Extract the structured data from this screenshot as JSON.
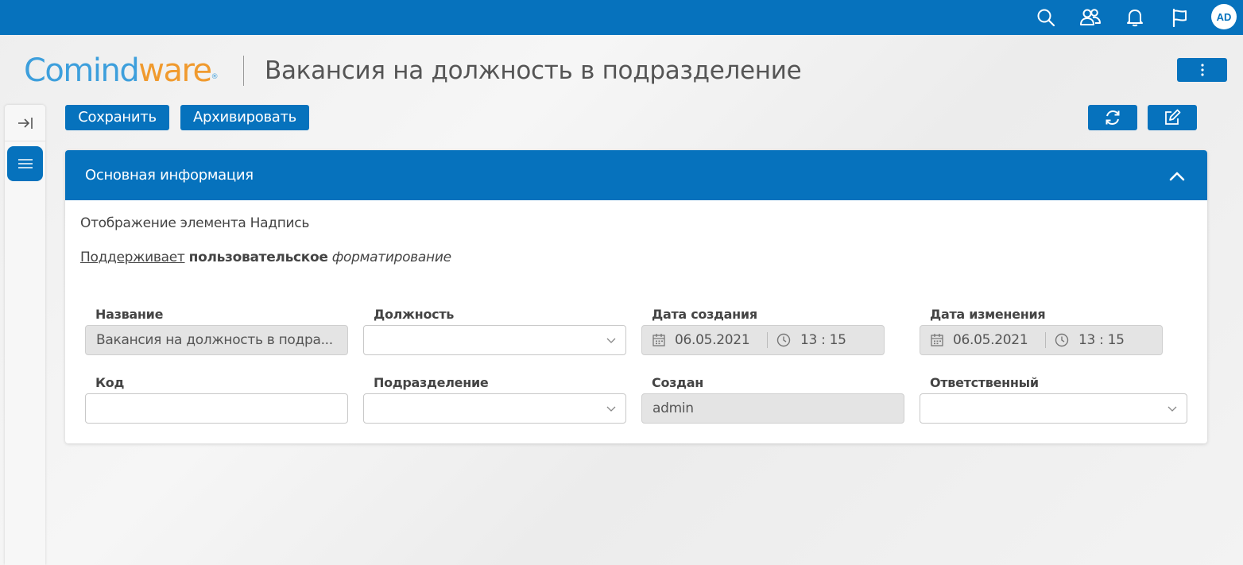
{
  "topbar": {
    "search_icon": "search-icon",
    "users_icon": "users-icon",
    "bell_icon": "bell-icon",
    "flag_icon": "flag-icon",
    "avatar": "AD"
  },
  "header": {
    "logo_part1": "Comind",
    "logo_part2": "ware",
    "logo_reg": "®",
    "title": "Вакансия на должность в подразделение"
  },
  "toolbar": {
    "save_label": "Сохранить",
    "archive_label": "Архивировать"
  },
  "panel": {
    "title": "Основная информация",
    "static_text": "Отображение элемента Надпись",
    "rich_text": {
      "underlined": "Поддерживает",
      "bold": "пользовательское",
      "italic": "форматирование"
    }
  },
  "fields": {
    "name": {
      "label": "Название",
      "value": "Вакансия на должность  в подра..."
    },
    "position": {
      "label": "Должность",
      "value": ""
    },
    "created_date": {
      "label": "Дата создания",
      "date": "06.05.2021",
      "time": "13 : 15"
    },
    "modified_date": {
      "label": "Дата изменения",
      "date": "06.05.2021",
      "time": "13 : 15"
    },
    "code": {
      "label": "Код",
      "value": ""
    },
    "department": {
      "label": "Подразделение",
      "value": ""
    },
    "created_by": {
      "label": "Создан",
      "value": "admin"
    },
    "responsible": {
      "label": "Ответственный",
      "value": ""
    }
  },
  "colors": {
    "primary": "#0672bd",
    "logo_blue": "#3d9fdc",
    "logo_orange": "#f09a2e"
  }
}
